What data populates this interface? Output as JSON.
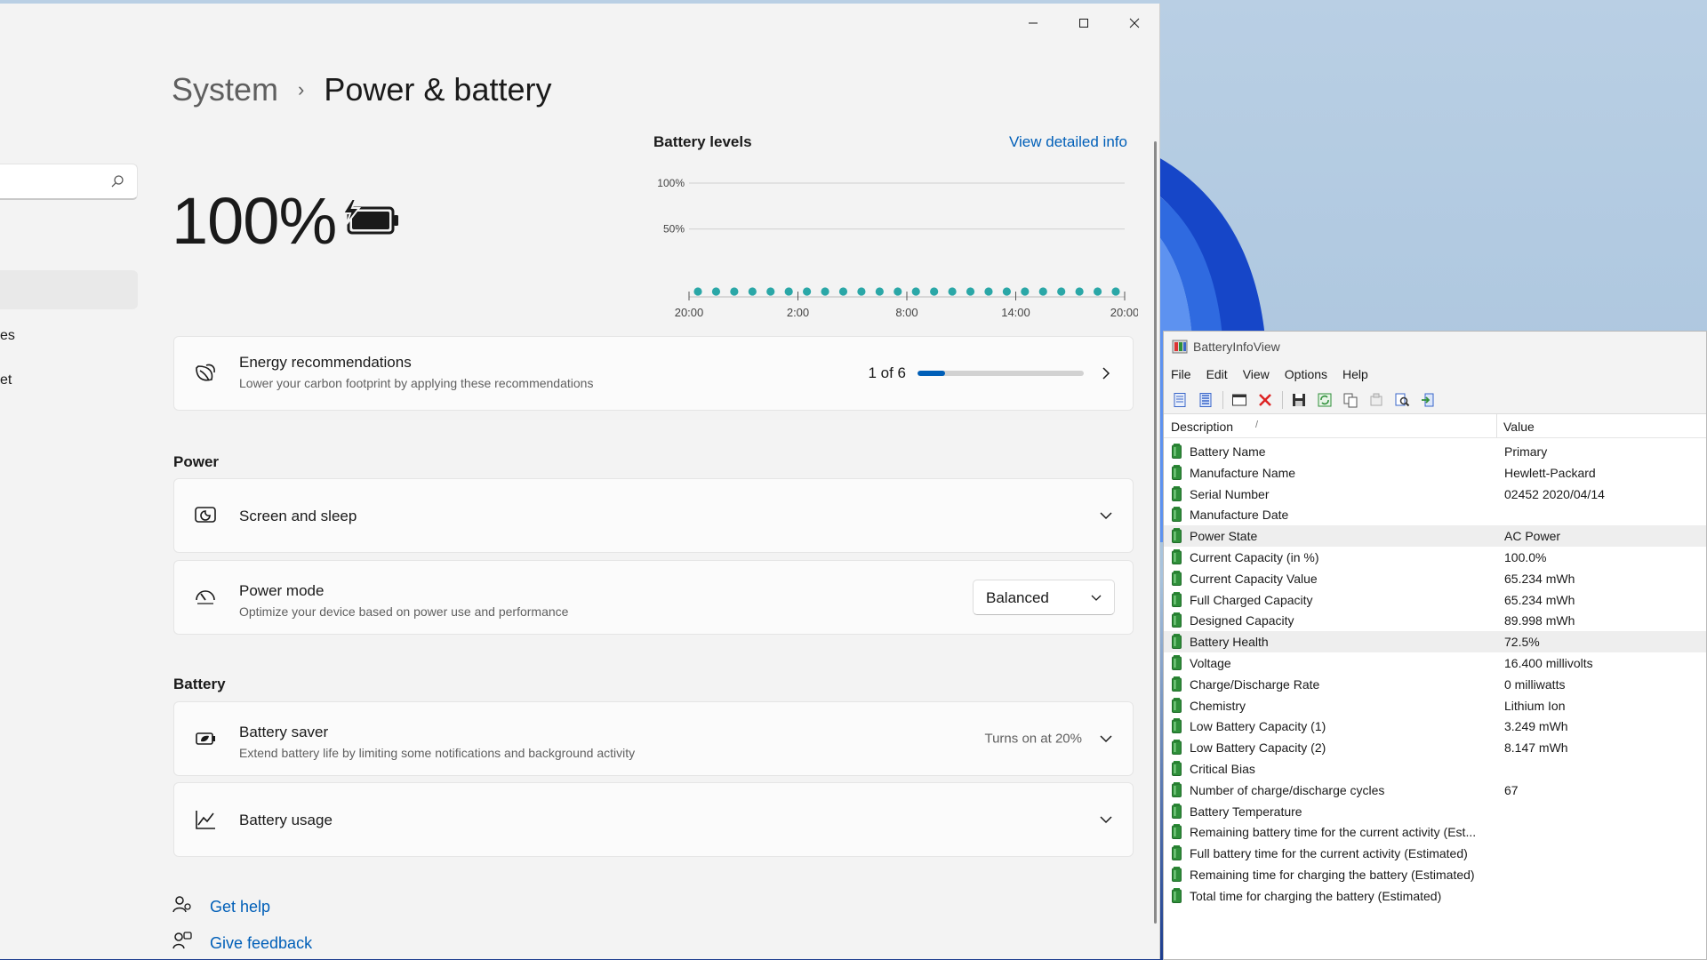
{
  "settings": {
    "breadcrumb": {
      "parent": "System",
      "separator": "›",
      "current": "Power & battery"
    },
    "nav": {
      "items": [
        "es",
        "et"
      ]
    },
    "battery_percent": "100%",
    "battery_levels": {
      "title": "Battery levels",
      "link": "View detailed info"
    },
    "energy": {
      "title": "Energy recommendations",
      "subtitle": "Lower your carbon footprint by applying these recommendations",
      "count": "1 of 6",
      "progress": 0.167
    },
    "power_section": "Power",
    "screen_sleep": {
      "title": "Screen and sleep"
    },
    "power_mode": {
      "title": "Power mode",
      "subtitle": "Optimize your device based on power use and performance",
      "value": "Balanced"
    },
    "battery_section": "Battery",
    "battery_saver": {
      "title": "Battery saver",
      "subtitle": "Extend battery life by limiting some notifications and background activity",
      "status": "Turns on at 20%"
    },
    "battery_usage": {
      "title": "Battery usage"
    },
    "help": {
      "get_help": "Get help",
      "give_feedback": "Give feedback"
    }
  },
  "chart_data": {
    "type": "scatter",
    "title": "Battery levels",
    "y_ticks": [
      "100%",
      "50%"
    ],
    "x_ticks": [
      "20:00",
      "2:00",
      "8:00",
      "14:00",
      "20:00"
    ],
    "ylim": [
      0,
      100
    ],
    "points": 24,
    "values": [
      0,
      0,
      0,
      0,
      0,
      0,
      0,
      0,
      0,
      0,
      0,
      0,
      0,
      0,
      0,
      0,
      0,
      0,
      0,
      0,
      0,
      0,
      0,
      0
    ],
    "color": "#2aa7a7",
    "grid": true
  },
  "biv": {
    "title": "BatteryInfoView",
    "menu": [
      "File",
      "Edit",
      "View",
      "Options",
      "Help"
    ],
    "columns": {
      "description": "Description",
      "sort_indicator": "/",
      "value": "Value"
    },
    "rows": [
      {
        "desc": "Battery Name",
        "value": "Primary"
      },
      {
        "desc": "Manufacture Name",
        "value": "Hewlett-Packard"
      },
      {
        "desc": "Serial Number",
        "value": "02452 2020/04/14"
      },
      {
        "desc": "Manufacture Date",
        "value": ""
      },
      {
        "desc": "Power State",
        "value": "AC Power"
      },
      {
        "desc": "Current Capacity (in %)",
        "value": "100.0%"
      },
      {
        "desc": "Current Capacity Value",
        "value": "65.234 mWh"
      },
      {
        "desc": "Full Charged Capacity",
        "value": "65.234 mWh"
      },
      {
        "desc": "Designed Capacity",
        "value": "89.998 mWh"
      },
      {
        "desc": "Battery Health",
        "value": "72.5%"
      },
      {
        "desc": "Voltage",
        "value": "16.400 millivolts"
      },
      {
        "desc": "Charge/Discharge Rate",
        "value": "0 milliwatts"
      },
      {
        "desc": "Chemistry",
        "value": "Lithium Ion"
      },
      {
        "desc": "Low Battery Capacity (1)",
        "value": "3.249 mWh"
      },
      {
        "desc": "Low Battery Capacity (2)",
        "value": "8.147 mWh"
      },
      {
        "desc": "Critical Bias",
        "value": ""
      },
      {
        "desc": "Number of charge/discharge cycles",
        "value": "67"
      },
      {
        "desc": "Battery Temperature",
        "value": ""
      },
      {
        "desc": "Remaining battery time for the current activity (Est...",
        "value": ""
      },
      {
        "desc": "Full battery time for the current activity (Estimated)",
        "value": ""
      },
      {
        "desc": "Remaining time for charging the battery (Estimated)",
        "value": ""
      },
      {
        "desc": "Total  time for charging the battery (Estimated)",
        "value": ""
      }
    ]
  },
  "colors": {
    "accent": "#005fb8",
    "chart_dot": "#2aa7a7",
    "row_icon": "#2f8f3a"
  }
}
